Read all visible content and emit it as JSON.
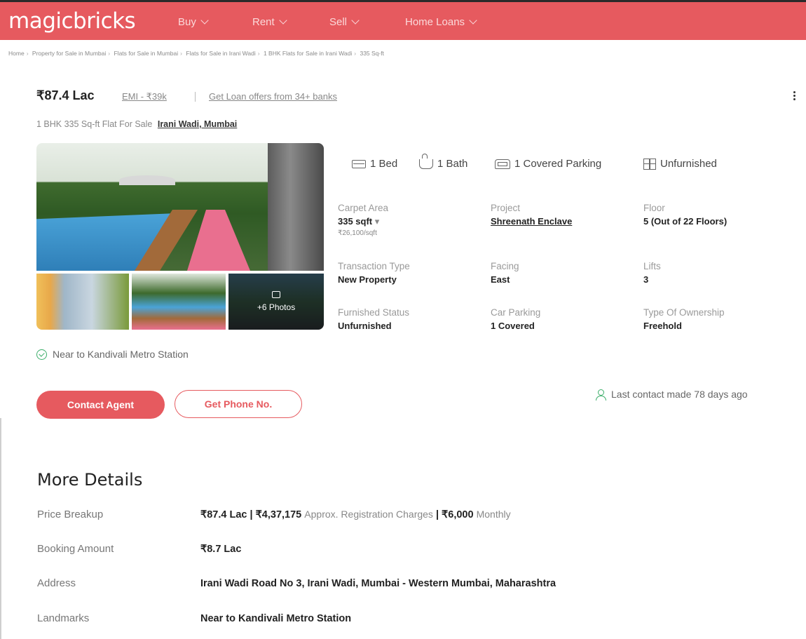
{
  "header": {
    "brand": "magicbricks",
    "nav": [
      {
        "label": "Buy"
      },
      {
        "label": "Rent"
      },
      {
        "label": "Sell"
      },
      {
        "label": "Home Loans"
      }
    ],
    "brand_color": "#e65a5f"
  },
  "breadcrumb": [
    "Home",
    "Property for Sale in Mumbai",
    "Flats for Sale in Mumbai",
    "Flats for Sale in Irani Wadi",
    "1 BHK Flats for Sale in Irani Wadi",
    "335 Sq-ft"
  ],
  "listing": {
    "price": "₹87.4 Lac",
    "emi": "EMI - ₹39k",
    "loan_offer": "Get Loan offers from 34+ banks",
    "subtitle": "1 BHK 335 Sq-ft Flat For Sale",
    "location": "Irani Wadi, Mumbai",
    "photos_more": "+6 Photos"
  },
  "features": {
    "bed": "1 Bed",
    "bath": "1 Bath",
    "parking": "1 Covered Parking",
    "furnishing": "Unfurnished"
  },
  "summary": {
    "carpet_area": {
      "label": "Carpet Area",
      "value": "335 sqft",
      "sub": "₹26,100/sqft"
    },
    "project": {
      "label": "Project",
      "value": "Shreenath Enclave"
    },
    "floor": {
      "label": "Floor",
      "value": "5 (Out of 22 Floors)"
    },
    "transaction": {
      "label": "Transaction Type",
      "value": "New Property"
    },
    "facing": {
      "label": "Facing",
      "value": "East"
    },
    "lifts": {
      "label": "Lifts",
      "value": "3"
    },
    "furnished": {
      "label": "Furnished Status",
      "value": "Unfurnished"
    },
    "car_parking": {
      "label": "Car Parking",
      "value": "1 Covered"
    },
    "ownership": {
      "label": "Type Of Ownership",
      "value": "Freehold"
    }
  },
  "near": "Near to Kandivali Metro Station",
  "actions": {
    "contact_agent": "Contact Agent",
    "get_phone": "Get Phone No.",
    "last_contact": "Last contact made 78 days ago"
  },
  "more_details": {
    "title": "More Details",
    "price_breakup": {
      "label": "Price Breakup",
      "price": "₹87.4 Lac |",
      "registration": "₹4,37,175",
      "registration_note": "Approx. Registration Charges",
      "monthly": "| ₹6,000",
      "monthly_note": "Monthly"
    },
    "booking_amount": {
      "label": "Booking Amount",
      "value": "₹8.7 Lac"
    },
    "address": {
      "label": "Address",
      "value": "Irani Wadi Road No 3, Irani Wadi, Mumbai - Western Mumbai, Maharashtra"
    },
    "landmarks": {
      "label": "Landmarks",
      "value": "Near to Kandivali Metro Station"
    }
  }
}
